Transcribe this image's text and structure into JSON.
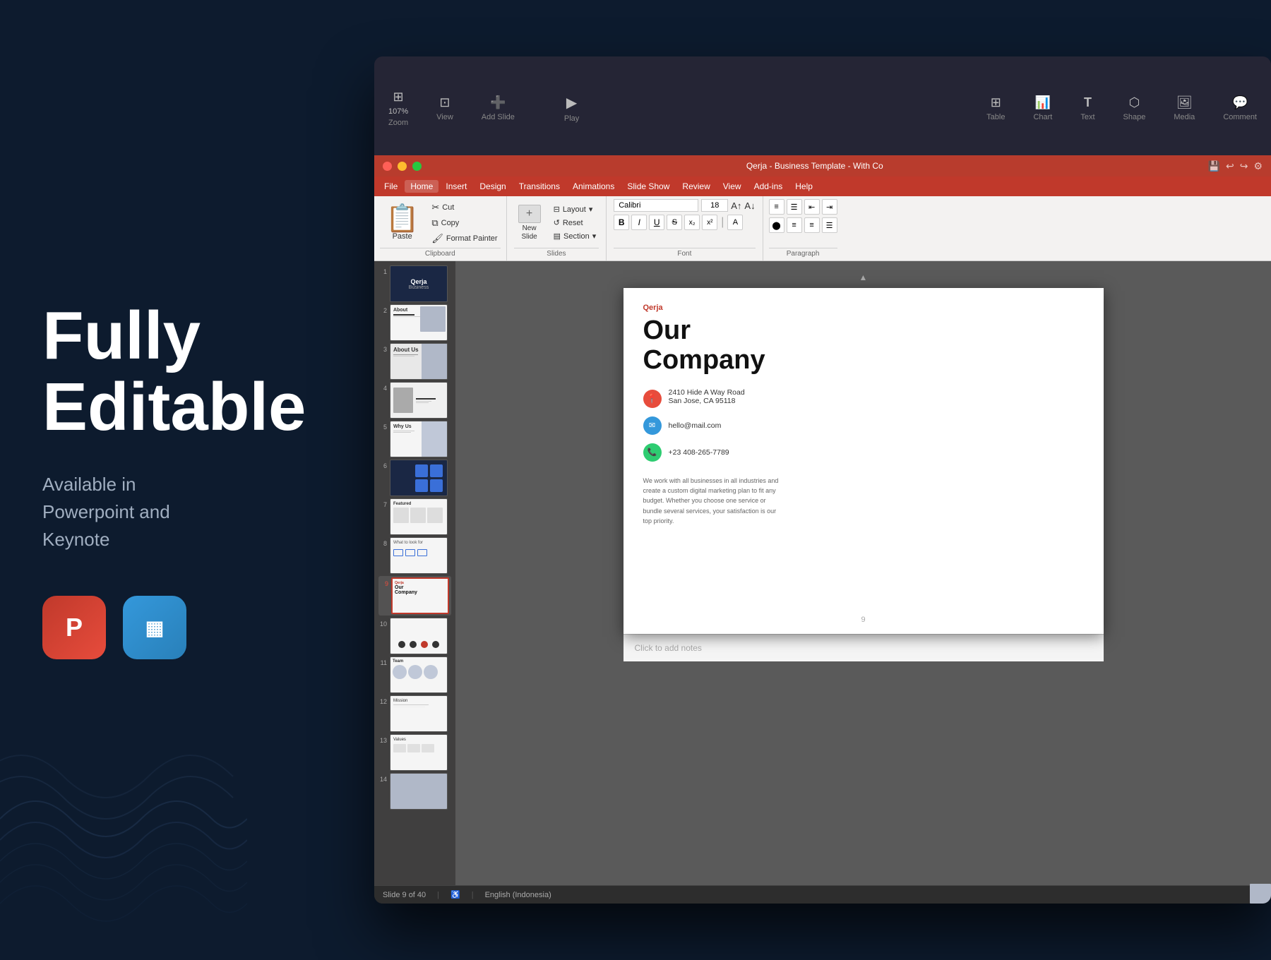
{
  "page": {
    "background_color": "#0d1b2e"
  },
  "left_panel": {
    "heading_line1": "Fully",
    "heading_line2": "Editable",
    "subtext": "Available in\nPowerpoint and\nKeynote",
    "powerpoint_icon_label": "P",
    "keynote_icon_label": "K"
  },
  "ppt_app": {
    "title": "Qerja - Business Template - With Co",
    "window_controls": [
      "close",
      "minimize",
      "maximize"
    ],
    "zoom_level": "107%",
    "toolbar_items": [
      {
        "label": "View",
        "icon": "⊞"
      },
      {
        "label": "Zoom",
        "icon": "🔍"
      },
      {
        "label": "Add Slide",
        "icon": "▶"
      },
      {
        "label": "Play",
        "icon": "▶"
      },
      {
        "label": "Table",
        "icon": "⊞"
      },
      {
        "label": "Chart",
        "icon": "📊"
      },
      {
        "label": "Text",
        "icon": "T"
      },
      {
        "label": "Shape",
        "icon": "⬡"
      },
      {
        "label": "Media",
        "icon": "🖼"
      },
      {
        "label": "Comment",
        "icon": "💬"
      }
    ],
    "menu_items": [
      {
        "label": "File",
        "active": false
      },
      {
        "label": "Home",
        "active": true
      },
      {
        "label": "Insert",
        "active": false
      },
      {
        "label": "Design",
        "active": false
      },
      {
        "label": "Transitions",
        "active": false
      },
      {
        "label": "Animations",
        "active": false
      },
      {
        "label": "Slide Show",
        "active": false
      },
      {
        "label": "Review",
        "active": false
      },
      {
        "label": "View",
        "active": false
      },
      {
        "label": "Add-ins",
        "active": false
      },
      {
        "label": "Help",
        "active": false
      }
    ],
    "ribbon": {
      "clipboard_group": {
        "label": "Clipboard",
        "paste_label": "Paste",
        "cut_label": "Cut",
        "copy_label": "Copy",
        "format_painter_label": "Format Painter"
      },
      "slides_group": {
        "label": "Slides",
        "new_slide_label": "New\nSlide",
        "layout_label": "Layout",
        "reset_label": "Reset",
        "section_label": "Section"
      },
      "font_group": {
        "label": "Font",
        "font_name": "Calibri",
        "font_size": "18",
        "bold": "B",
        "italic": "I",
        "underline": "U",
        "strikethrough": "S",
        "subscript": "x₂",
        "superscript": "x²"
      },
      "paragraph_group": {
        "label": "Paragraph"
      }
    },
    "slides": [
      {
        "number": 1,
        "type": "dark_header"
      },
      {
        "number": 2,
        "type": "image_right"
      },
      {
        "number": 3,
        "type": "about_us"
      },
      {
        "number": 4,
        "type": "person"
      },
      {
        "number": 5,
        "type": "text_image"
      },
      {
        "number": 6,
        "type": "blue_squares"
      },
      {
        "number": 7,
        "type": "featured"
      },
      {
        "number": 8,
        "type": "arrows"
      },
      {
        "number": 9,
        "type": "contact",
        "active": true
      },
      {
        "number": 10,
        "type": "dots"
      },
      {
        "number": 11,
        "type": "team"
      },
      {
        "number": 12,
        "type": "mission"
      },
      {
        "number": 13,
        "type": "values"
      },
      {
        "number": 14,
        "type": "portfolio"
      }
    ],
    "current_slide": {
      "number": 9,
      "brand": "Qerja",
      "title_line1": "Our",
      "title_line2": "Company",
      "address_line1": "2410 Hide A Way Road",
      "address_line2": "San Jose, CA 95118",
      "email": "hello@mail.com",
      "phone": "+23 408-265-7789",
      "description": "We work with all businesses in all industries and create a custom digital marketing plan to fit any budget. Whether you choose one service or bundle several services, your satisfaction is our top priority.",
      "page_number": "9"
    },
    "status_bar": {
      "slide_info": "Slide 9 of 40",
      "language": "English (Indonesia)"
    },
    "notes_placeholder": "Click to add notes"
  }
}
